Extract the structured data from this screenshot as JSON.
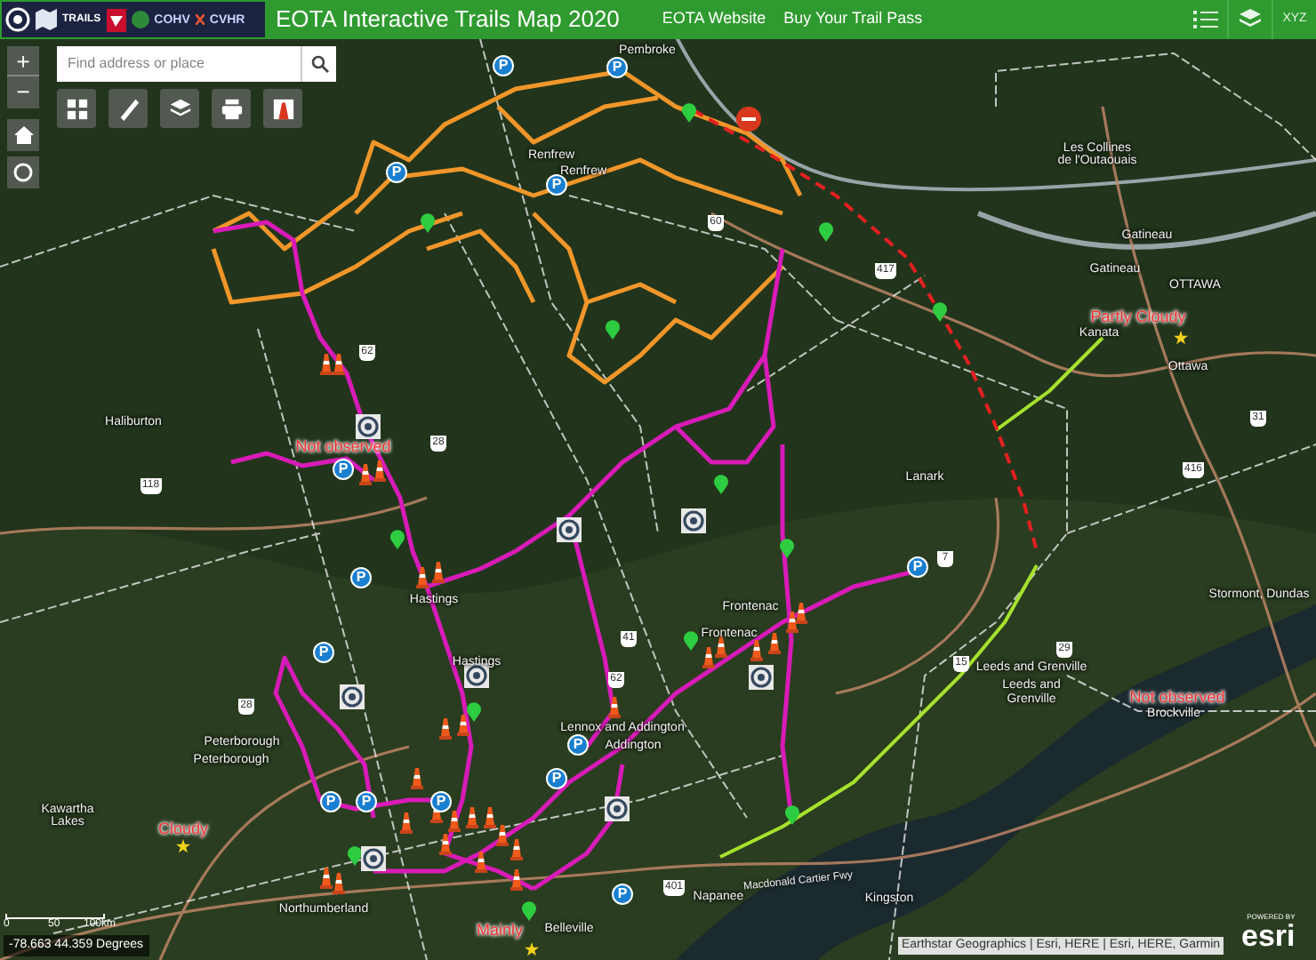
{
  "header": {
    "logo_texts": [
      "TRAILS",
      "COHV",
      "CVHR"
    ],
    "title": "EOTA Interactive Trails Map 2020",
    "links": [
      "EOTA Website",
      "Buy Your Trail Pass"
    ],
    "xyz_button": "XYZ"
  },
  "map_controls": {
    "zoom_in": "+",
    "zoom_out": "−"
  },
  "search": {
    "placeholder": "Find address or place"
  },
  "weather_labels": [
    "Partly Cloudy",
    "Not observed",
    "Not observed",
    "Cloudy",
    "Mainly"
  ],
  "place_labels": [
    "Pembroke",
    "Renfrew",
    "Renfrew",
    "Les Collines",
    "de l'Outaouais",
    "Gatineau",
    "Gatineau",
    "OTTAWA",
    "Kanata",
    "Ottawa",
    "Lanark",
    "Frontenac",
    "Frontenac",
    "Stormont, Dundas",
    "Leeds and Grenville",
    "Leeds and",
    "Grenville",
    "Brockville",
    "Haliburton",
    "Hastings",
    "Hastings",
    "Lennox and Addington",
    "Addington",
    "Peterborough",
    "Peterborough",
    "Kawartha",
    "Lakes",
    "Northumberland",
    "Napanee",
    "Kingston",
    "Belleville"
  ],
  "road_labels": [
    "Macdonald Cartier Fwy"
  ],
  "highway_shields": [
    "60",
    "417",
    "7",
    "416",
    "31",
    "29",
    "15",
    "62",
    "28",
    "118",
    "62",
    "28",
    "41",
    "401"
  ],
  "parking_markers": [
    "P",
    "P",
    "P",
    "P",
    "P",
    "P",
    "P",
    "P",
    "P",
    "P",
    "P",
    "P",
    "P",
    "P"
  ],
  "scale_bar": {
    "ticks": [
      "0",
      "50",
      "100km"
    ]
  },
  "coordinates": "-78.663 44.359 Degrees",
  "attribution": "Earthstar Geographics | Esri, HERE | Esri, HERE, Garmin",
  "esri_logo": {
    "caption": "POWERED BY",
    "wordmark": "esri"
  }
}
